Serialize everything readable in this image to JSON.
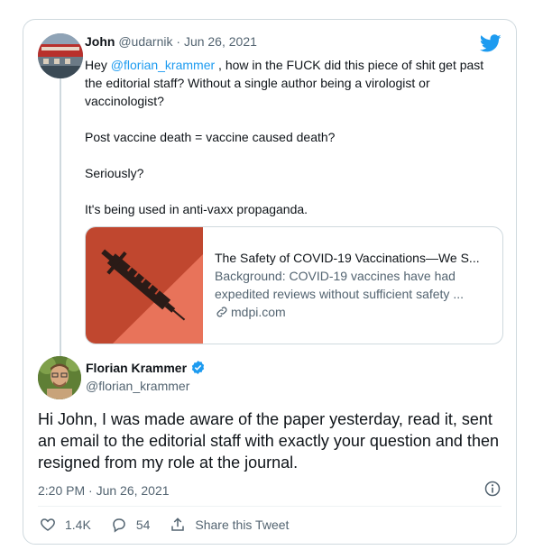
{
  "reply": {
    "name": "John",
    "handle": "@udarnik",
    "separator": "·",
    "date": "Jun 26, 2021",
    "line1_prefix": "Hey ",
    "mention": "@florian_krammer",
    "line1_rest": " , how in the FUCK did this piece of shit get past the editorial staff? Without a single author being a virologist or vaccinologist?",
    "para2": "Post vaccine death = vaccine caused death?",
    "para3": "Seriously?",
    "para4": "It's being used in anti-vaxx propaganda."
  },
  "link_card": {
    "title": "The Safety of COVID-19 Vaccinations—We S...",
    "description": "Background: COVID-19 vaccines have had expedited reviews without sufficient safety ...",
    "domain": "mdpi.com",
    "thumb_colors": [
      "#c0472f",
      "#e8735a"
    ]
  },
  "tweet": {
    "author_name": "Florian Krammer",
    "author_handle": "@florian_krammer",
    "text": "Hi John, I was made aware of the paper yesterday, read it, sent an email to the editorial staff with exactly your question and then resigned from my role at the journal.",
    "timestamp": "2:20 PM · Jun 26, 2021",
    "likes": "1.4K",
    "replies": "54",
    "share_label": "Share this Tweet"
  },
  "colors": {
    "accent": "#1d9bf0",
    "secondary_text": "#536471",
    "border": "#cfd9de"
  },
  "icons": [
    "twitter-bird-icon",
    "verified-badge-icon",
    "link-icon",
    "info-icon",
    "heart-icon",
    "reply-bubble-icon",
    "share-icon"
  ]
}
